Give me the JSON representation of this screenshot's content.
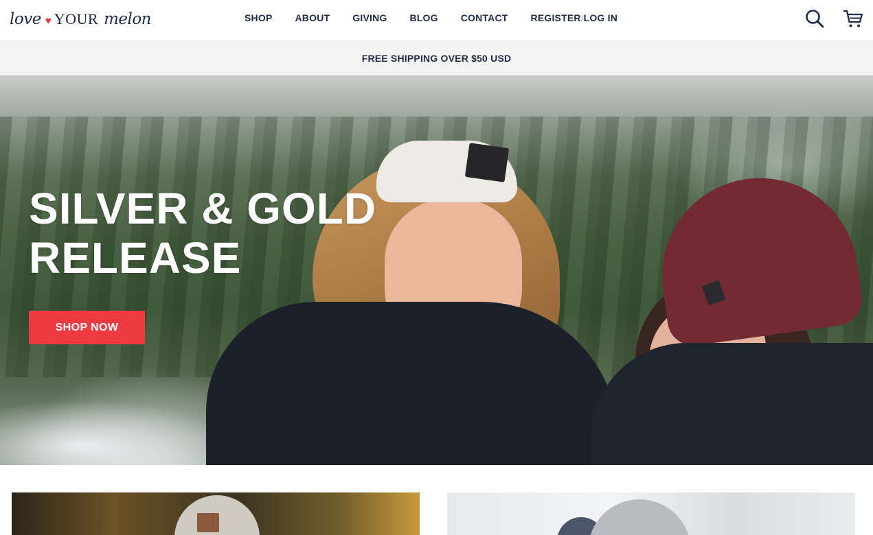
{
  "brand": {
    "logo_love": "love",
    "logo_heart": "♥",
    "logo_your": "YOUR",
    "logo_melon": "melon",
    "accent_color": "#ef3a42",
    "navy_color": "#1f2a44"
  },
  "nav": {
    "items": [
      {
        "label": "SHOP"
      },
      {
        "label": "ABOUT"
      },
      {
        "label": "GIVING"
      },
      {
        "label": "BLOG"
      },
      {
        "label": "CONTACT"
      }
    ],
    "register_label": "REGISTER",
    "separator": "/",
    "login_label": "LOG IN"
  },
  "header_icons": {
    "search": "search-icon",
    "cart": "cart-icon"
  },
  "promo": {
    "text": "FREE SHIPPING OVER $50 USD"
  },
  "hero": {
    "title_line1": "SILVER & GOLD",
    "title_line2": "RELEASE",
    "cta_label": "SHOP NOW"
  }
}
